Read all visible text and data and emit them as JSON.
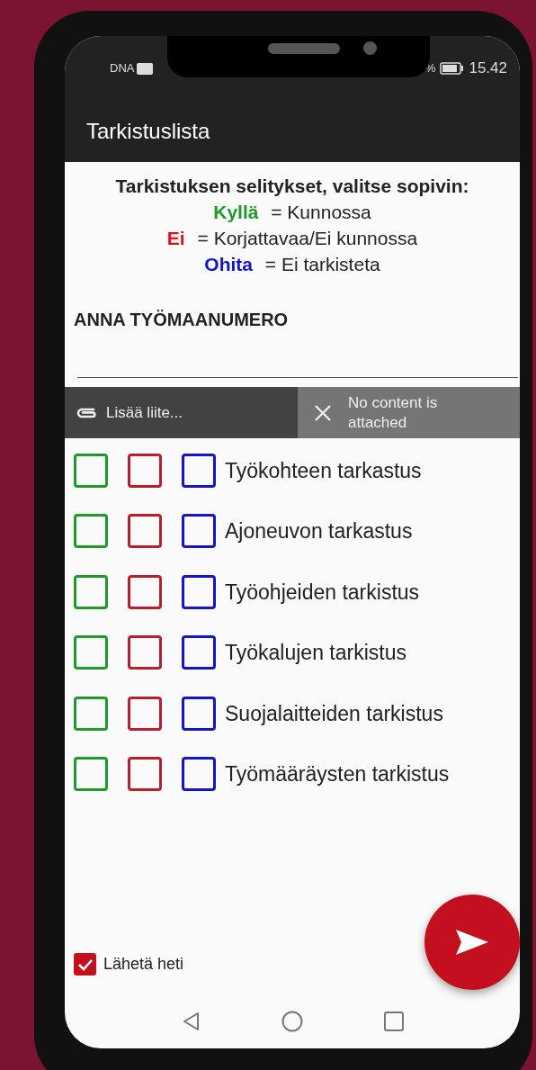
{
  "status_bar": {
    "carrier": "DNA",
    "battery_percent": "%",
    "time": "15.42"
  },
  "app_bar": {
    "title": "Tarkistuslista"
  },
  "legend": {
    "title": "Tarkistuksen selitykset, valitse sopivin:",
    "items": [
      {
        "term": "Kyllä",
        "meaning": "= Kunnossa",
        "color": "#1e9a2a"
      },
      {
        "term": "Ei",
        "meaning": "= Korjattavaa/Ei kunnossa",
        "color": "#e0101a"
      },
      {
        "term": "Ohita",
        "meaning": "= Ei tarkisteta",
        "color": "#1414c8"
      }
    ]
  },
  "site_number": {
    "label": "ANNA TYÖMAANUMERO"
  },
  "attachment": {
    "add_label": "Lisää liite...",
    "status": "No content is attached"
  },
  "checklist": [
    {
      "label": "Työkohteen tarkastus",
      "boxes": [
        {
          "color": "#1e9a2a",
          "checked": false
        },
        {
          "color": "#b5202e",
          "checked": false
        },
        {
          "color": "#1414c8",
          "checked": false
        }
      ]
    },
    {
      "label": "Ajoneuvon tarkastus",
      "boxes": [
        {
          "color": "#1e9a2a",
          "checked": false
        },
        {
          "color": "#b5202e",
          "checked": false
        },
        {
          "color": "#1414c8",
          "checked": false
        }
      ]
    },
    {
      "label": "Työohjeiden tarkistus",
      "boxes": [
        {
          "color": "#1e9a2a",
          "checked": false
        },
        {
          "color": "#b5202e",
          "checked": false
        },
        {
          "color": "#1414c8",
          "checked": false
        }
      ]
    },
    {
      "label": "Työkalujen tarkistus",
      "boxes": [
        {
          "color": "#1e9a2a",
          "checked": false
        },
        {
          "color": "#b5202e",
          "checked": false
        },
        {
          "color": "#1414c8",
          "checked": false
        }
      ]
    },
    {
      "label": "Suojalaitteiden tarkistus",
      "boxes": [
        {
          "color": "#1e9a2a",
          "checked": false
        },
        {
          "color": "#b5202e",
          "checked": false
        },
        {
          "color": "#1414c8",
          "checked": false
        }
      ]
    },
    {
      "label": "Työmääräysten tarkistus",
      "boxes": [
        {
          "color": "#1e9a2a",
          "checked": false
        },
        {
          "color": "#b5202e",
          "checked": false
        },
        {
          "color": "#1414c8",
          "checked": false
        }
      ]
    }
  ],
  "send_now": {
    "label": "Lähetä heti",
    "checked": true
  }
}
